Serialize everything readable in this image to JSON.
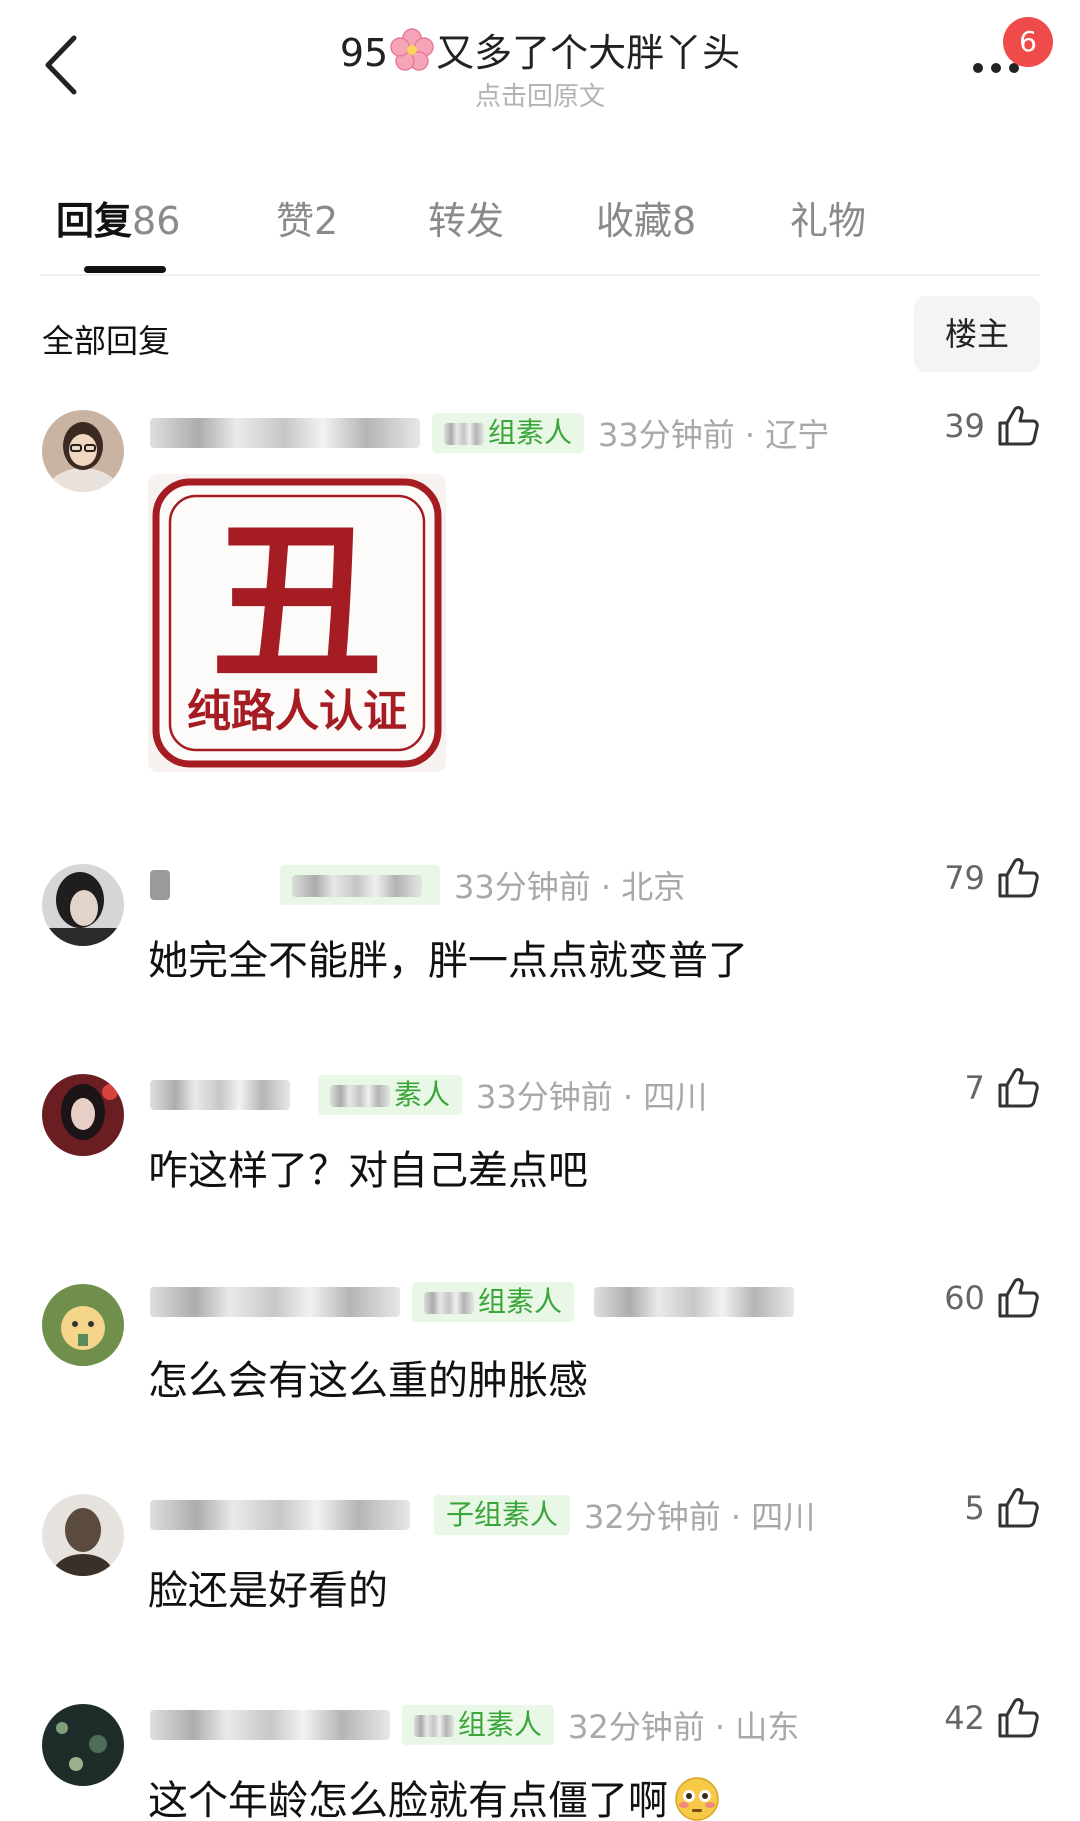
{
  "header": {
    "title_prefix": "95",
    "title_suffix": "又多了个大胖丫头",
    "subtitle": "点击回原文",
    "notification_count": "6"
  },
  "tabs": [
    {
      "label": "回复",
      "count": "86",
      "active": true
    },
    {
      "label": "赞",
      "count": "2",
      "active": false
    },
    {
      "label": "转发",
      "count": "",
      "active": false
    },
    {
      "label": "收藏",
      "count": "8",
      "active": false
    },
    {
      "label": "礼物",
      "count": "",
      "active": false
    }
  ],
  "filter": {
    "label": "全部回复",
    "owner_button": "楼主"
  },
  "sticker": {
    "big_char": "丑",
    "caption": "纯路人认证"
  },
  "comments": [
    {
      "group": "组素人",
      "time_loc": "33分钟前 · 辽宁",
      "likes": "39",
      "text": ""
    },
    {
      "group": "",
      "time_loc": "33分钟前 · 北京",
      "likes": "79",
      "text": "她完全不能胖，胖一点点就变普了"
    },
    {
      "group": "素人",
      "time_loc": "33分钟前 · 四川",
      "likes": "7",
      "text": "咋这样了？对自己差点吧"
    },
    {
      "group": "组素人",
      "time_loc": "",
      "likes": "60",
      "text": "怎么会有这么重的肿胀感"
    },
    {
      "group": "子组素人",
      "time_loc": "32分钟前 · 四川",
      "likes": "5",
      "text": "脸还是好看的"
    },
    {
      "group": "组素人",
      "time_loc": "32分钟前 · 山东",
      "likes": "42",
      "text": "这个年龄怎么脸就有点僵了啊"
    }
  ],
  "colors": {
    "badge": "#f04b4b",
    "group_tag_bg": "#e9f8e6",
    "group_tag_text": "#3aa53a",
    "sticker_red": "#a51d22"
  }
}
